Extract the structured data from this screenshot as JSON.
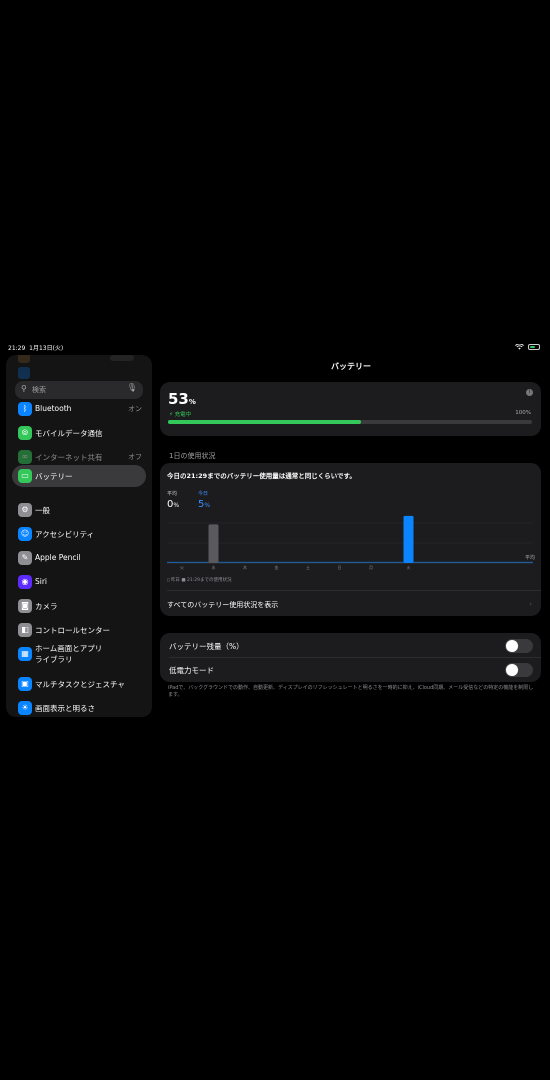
{
  "status_bar": {
    "time": "21:29",
    "date": "1月13日(火)"
  },
  "sidebar": {
    "search_placeholder": "検索",
    "items": [
      {
        "label": "Bluetooth",
        "value": "オン",
        "icon": "bluetooth-icon",
        "color": "#0a84ff",
        "glyph": "ᛒ"
      },
      {
        "label": "モバイルデータ通信",
        "value": "",
        "icon": "antenna-icon",
        "color": "#34c759",
        "glyph": "⦾"
      },
      {
        "label": "インターネット共有",
        "value": "オフ",
        "icon": "link-icon",
        "color": "#34c759",
        "glyph": "∞"
      },
      {
        "label": "バッテリー",
        "value": "",
        "icon": "battery-icon",
        "color": "#34c759",
        "glyph": "▭"
      },
      {
        "label": "一般",
        "value": "",
        "icon": "gear-icon",
        "color": "#8e8e93",
        "glyph": "⚙"
      },
      {
        "label": "アクセシビリティ",
        "value": "",
        "icon": "accessibility-icon",
        "color": "#0a84ff",
        "glyph": "☺"
      },
      {
        "label": "Apple Pencil",
        "value": "",
        "icon": "pencil-icon",
        "color": "#8e8e93",
        "glyph": "✎"
      },
      {
        "label": "Siri",
        "value": "",
        "icon": "siri-icon",
        "color": "#5e2bff",
        "glyph": "◉"
      },
      {
        "label": "カメラ",
        "value": "",
        "icon": "camera-icon",
        "color": "#8e8e93",
        "glyph": "◙"
      },
      {
        "label": "コントロールセンター",
        "value": "",
        "icon": "control-center-icon",
        "color": "#8e8e93",
        "glyph": "◧"
      },
      {
        "label": "ホーム画面とアプリ",
        "label2": "ライブラリ",
        "value": "",
        "icon": "home-screen-icon",
        "color": "#0a84ff",
        "glyph": "▦"
      },
      {
        "label": "マルチタスクとジェスチャ",
        "value": "",
        "icon": "multitasking-icon",
        "color": "#0a84ff",
        "glyph": "▣"
      },
      {
        "label": "画面表示と明るさ",
        "value": "",
        "icon": "brightness-icon",
        "color": "#0a84ff",
        "glyph": "☀"
      }
    ]
  },
  "main": {
    "title": "バッテリー",
    "battery": {
      "percent": "53",
      "unit": "%",
      "level": 0.53,
      "charging_label": "充電中",
      "max_label": "100%"
    },
    "section_header": "1日の使用状況",
    "usage": {
      "headline": "今日の21:29までのバッテリー使用量は通常と同じくらいです。",
      "avg_label": "平均",
      "avg_value": "0",
      "today_label": "今日",
      "today_value": "5",
      "unit": "%",
      "chart_avg_label": "平均",
      "legend": "▯ 昨日  ■ 21:29までの使用状況",
      "link": "すべてのバッテリー使用状況を表示"
    },
    "toggles": [
      {
        "label": "バッテリー残量（%）",
        "on": false
      },
      {
        "label": "低電力モード",
        "on": false
      }
    ],
    "footnote": "iPadで、バックグラウンドでの動作、自動更新、ディスプレイのリフレッシュレートと明るさを一時的に抑え、iCloud同期、メール受信などの特定の機能を制限します。"
  },
  "chart_data": {
    "type": "bar",
    "categories": [
      "火",
      "水",
      "木",
      "金",
      "土",
      "日",
      "月",
      "火"
    ],
    "series": [
      {
        "values": [
          0,
          9,
          0,
          0,
          0,
          0,
          0,
          11
        ]
      }
    ],
    "highlight_index": 7,
    "ylim": [
      0,
      14
    ],
    "colors": {
      "past": "#5a5a5e",
      "today": "#0a84ff"
    }
  }
}
